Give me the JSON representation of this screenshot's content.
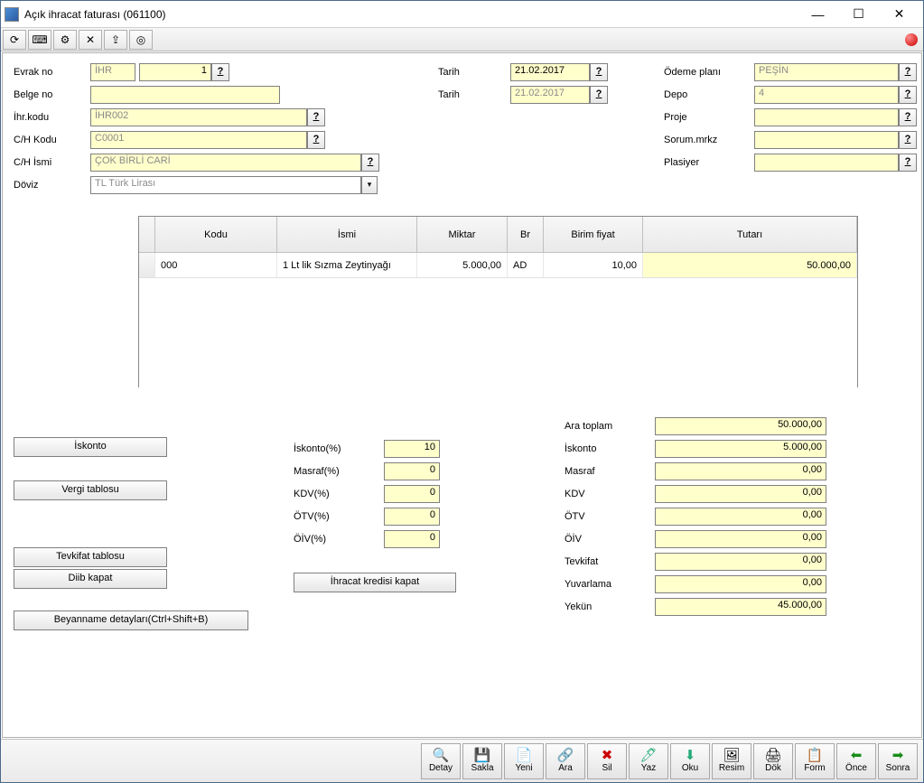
{
  "window": {
    "title": "Açık ihracat faturası (061100)"
  },
  "toolbar_icons": [
    "⟳",
    "⌨",
    "⚙",
    "✕",
    "⇪",
    "◎"
  ],
  "form": {
    "evrak_no_label": "Evrak no",
    "evrak_no_prefix": "İHR",
    "evrak_no_num": "1",
    "belge_no_label": "Belge no",
    "belge_no": "",
    "ihr_kodu_label": "İhr.kodu",
    "ihr_kodu": "İHR002",
    "ch_kodu_label": "C/H Kodu",
    "ch_kodu": "C0001",
    "ch_ismi_label": "C/H İsmi",
    "ch_ismi": "ÇOK BİRLİ CARİ",
    "doviz_label": "Döviz",
    "doviz": "TL  Türk Lirası",
    "tarih_label": "Tarih",
    "tarih1": "21.02.2017",
    "tarih2_label": "Tarih",
    "tarih2": "21.02.2017",
    "odeme_label": "Ödeme planı",
    "odeme": "PEŞİN",
    "depo_label": "Depo",
    "depo": "4",
    "proje_label": "Proje",
    "proje": "",
    "sorum_label": "Sorum.mrkz",
    "sorum": "",
    "plasiyer_label": "Plasiyer",
    "plasiyer": ""
  },
  "grid": {
    "headers": {
      "kodu": "Kodu",
      "ismi": "İsmi",
      "miktar": "Miktar",
      "br": "Br",
      "birim_fiyat": "Birim fiyat",
      "tutar": "Tutarı"
    },
    "row": {
      "kodu": "000",
      "ismi": "1 Lt lik Sızma Zeytinyağı",
      "miktar": "5.000,00",
      "br": "AD",
      "birim_fiyat": "10,00",
      "tutar": "50.000,00"
    }
  },
  "buttons": {
    "iskonto": "İskonto",
    "vergi": "Vergi tablosu",
    "tevkifat": "Tevkifat tablosu",
    "diib": "Diib kapat",
    "ihracat_kredisi": "İhracat kredisi kapat",
    "beyanname": "Beyanname detayları(Ctrl+Shift+B)"
  },
  "mid": {
    "iskonto_pct_label": "İskonto(%)",
    "iskonto_pct": "10",
    "masraf_pct_label": "Masraf(%)",
    "masraf_pct": "0",
    "kdv_pct_label": "KDV(%)",
    "kdv_pct": "0",
    "otv_pct_label": "ÖTV(%)",
    "otv_pct": "0",
    "oiv_pct_label": "ÖİV(%)",
    "oiv_pct": "0"
  },
  "totals": {
    "ara_toplam_label": "Ara toplam",
    "ara_toplam": "50.000,00",
    "iskonto_label": "İskonto",
    "iskonto": "5.000,00",
    "masraf_label": "Masraf",
    "masraf": "0,00",
    "kdv_label": "KDV",
    "kdv": "0,00",
    "otv_label": "ÖTV",
    "otv": "0,00",
    "oiv_label": "ÖİV",
    "oiv": "0,00",
    "tevkifat_label": "Tevkifat",
    "tevkifat": "0,00",
    "yuvarlama_label": "Yuvarlama",
    "yuvarlama": "0,00",
    "yekun_label": "Yekün",
    "yekun": "45.000,00"
  },
  "bottom": [
    {
      "icon": "🔍",
      "label": "Detay"
    },
    {
      "icon": "💾",
      "label": "Sakla"
    },
    {
      "icon": "📄",
      "label": "Yeni"
    },
    {
      "icon": "🔗",
      "label": "Ara"
    },
    {
      "icon": "✖",
      "label": "Sil"
    },
    {
      "icon": "🖊",
      "label": "Yaz"
    },
    {
      "icon": "⬇",
      "label": "Oku"
    },
    {
      "icon": "🖼",
      "label": "Resim"
    },
    {
      "icon": "🖨",
      "label": "Dök"
    },
    {
      "icon": "📋",
      "label": "Form"
    },
    {
      "icon": "⬅",
      "label": "Önce"
    },
    {
      "icon": "➡",
      "label": "Sonra"
    }
  ]
}
